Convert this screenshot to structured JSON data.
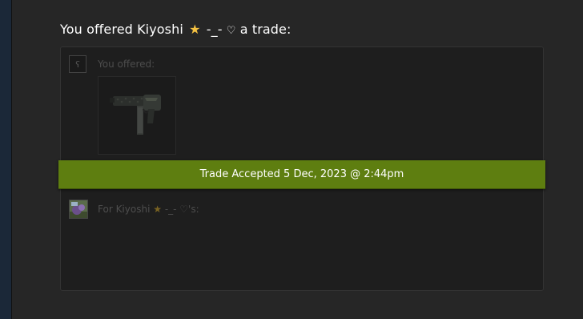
{
  "heading": {
    "prefix": "You offered Kiyoshi",
    "star": "★",
    "suffix_mid": "-_-",
    "heart": "♡",
    "suffix_end": "a trade:"
  },
  "offer": {
    "you_label": "You offered:",
    "item_icon": "smg-weapon-icon"
  },
  "banner": {
    "text": "Trade Accepted 5 Dec, 2023 @ 2:44pm",
    "color": "#5e7e10"
  },
  "for": {
    "prefix": "For Kiyoshi",
    "star": "★",
    "suffix": "-_- ♡'s:"
  }
}
